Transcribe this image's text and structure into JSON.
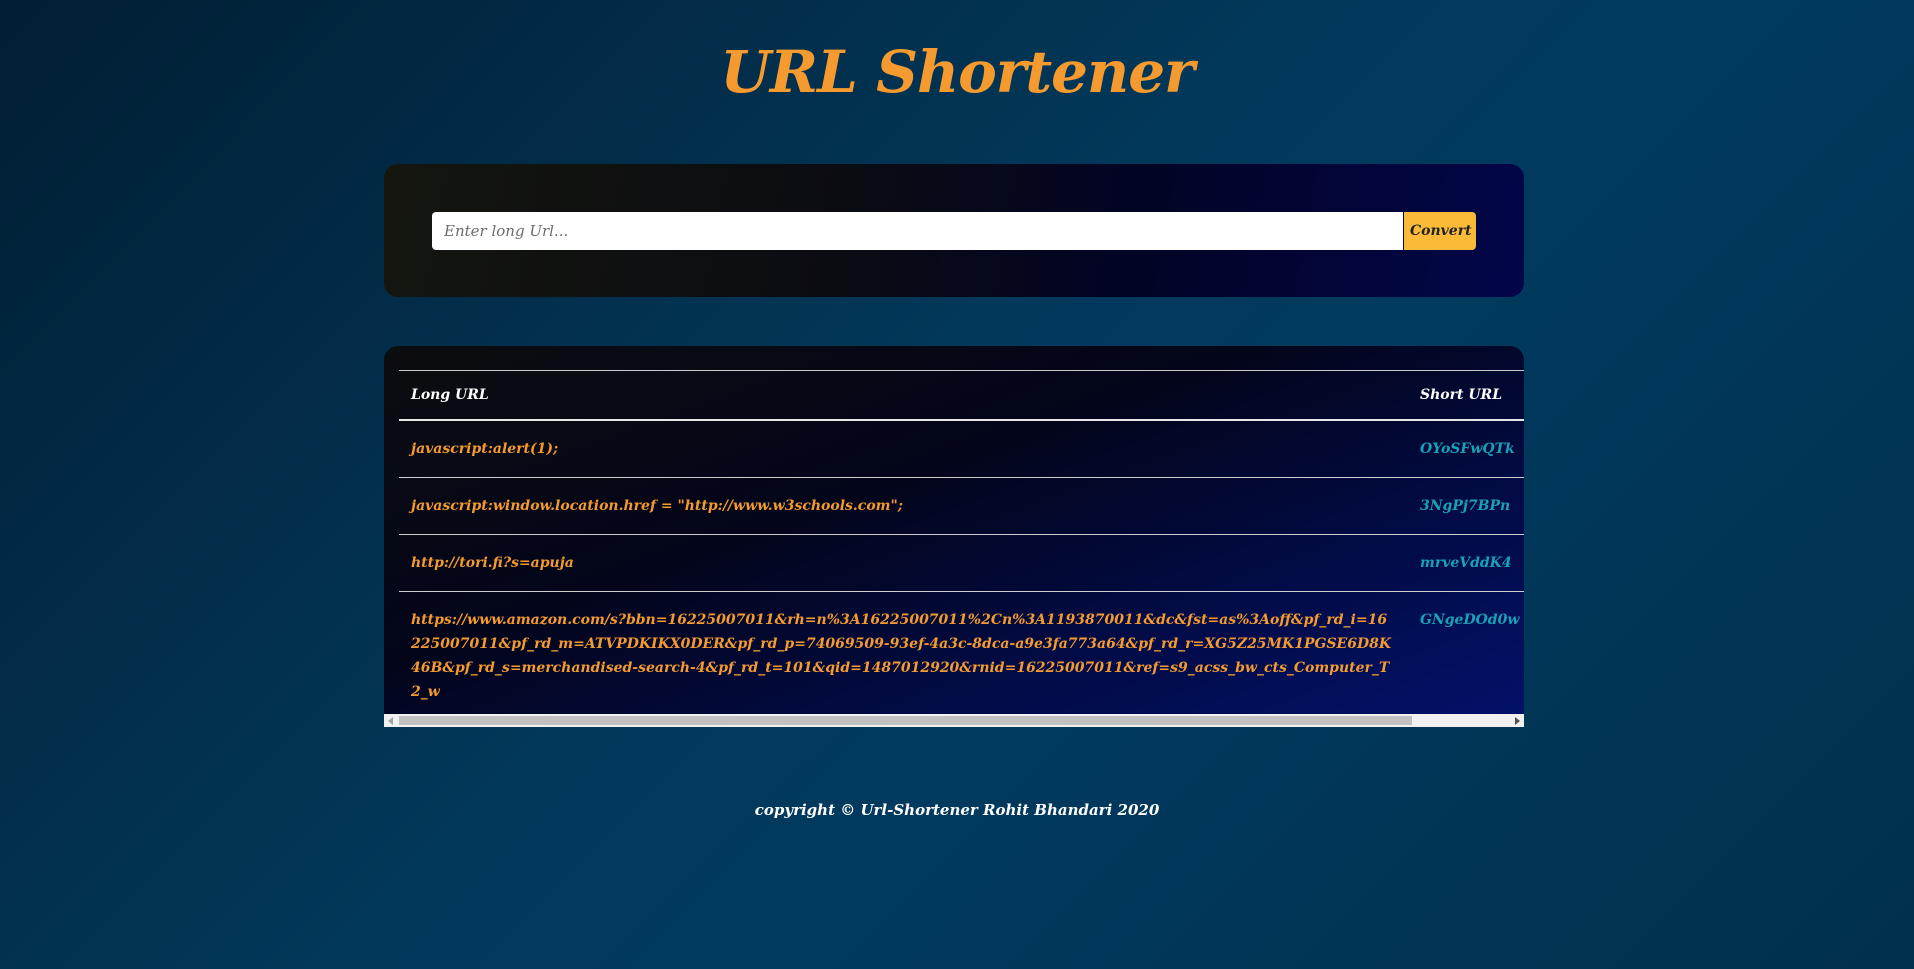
{
  "header": {
    "title": "URL Shortener"
  },
  "form": {
    "placeholder": "Enter long Url...",
    "value": "",
    "button_label": "Convert"
  },
  "table": {
    "columns": [
      "Long URL",
      "Short URL"
    ],
    "rows": [
      {
        "long_url": "javascript:alert(1);",
        "short_url": "OYoSFwQTk"
      },
      {
        "long_url": "javascript:window.location.href = \"http://www.w3schools.com\";",
        "short_url": "3NgPj7BPn"
      },
      {
        "long_url": "http://tori.fi?s=apuja",
        "short_url": "mrveVddK4"
      },
      {
        "long_url": "https://www.amazon.com/s?bbn=16225007011&rh=n%3A16225007011%2Cn%3A1193870011&dc&fst=as%3Aoff&pf_rd_i=16225007011&pf_rd_m=ATVPDKIKX0DER&pf_rd_p=74069509-93ef-4a3c-8dca-a9e3fa773a64&pf_rd_r=XG5Z25MK1PGSE6D8K46B&pf_rd_s=merchandised-search-4&pf_rd_t=101&qid=1487012920&rnid=16225007011&ref=s9_acss_bw_cts_Computer_T2_w",
        "short_url": "GNgeDOd0w"
      }
    ]
  },
  "footer": {
    "text": "copyright © Url-Shortener Rohit Bhandari 2020"
  },
  "colors": {
    "accent": "#f59a2f",
    "button": "#fbbb38",
    "short_link": "#17a2b8"
  }
}
